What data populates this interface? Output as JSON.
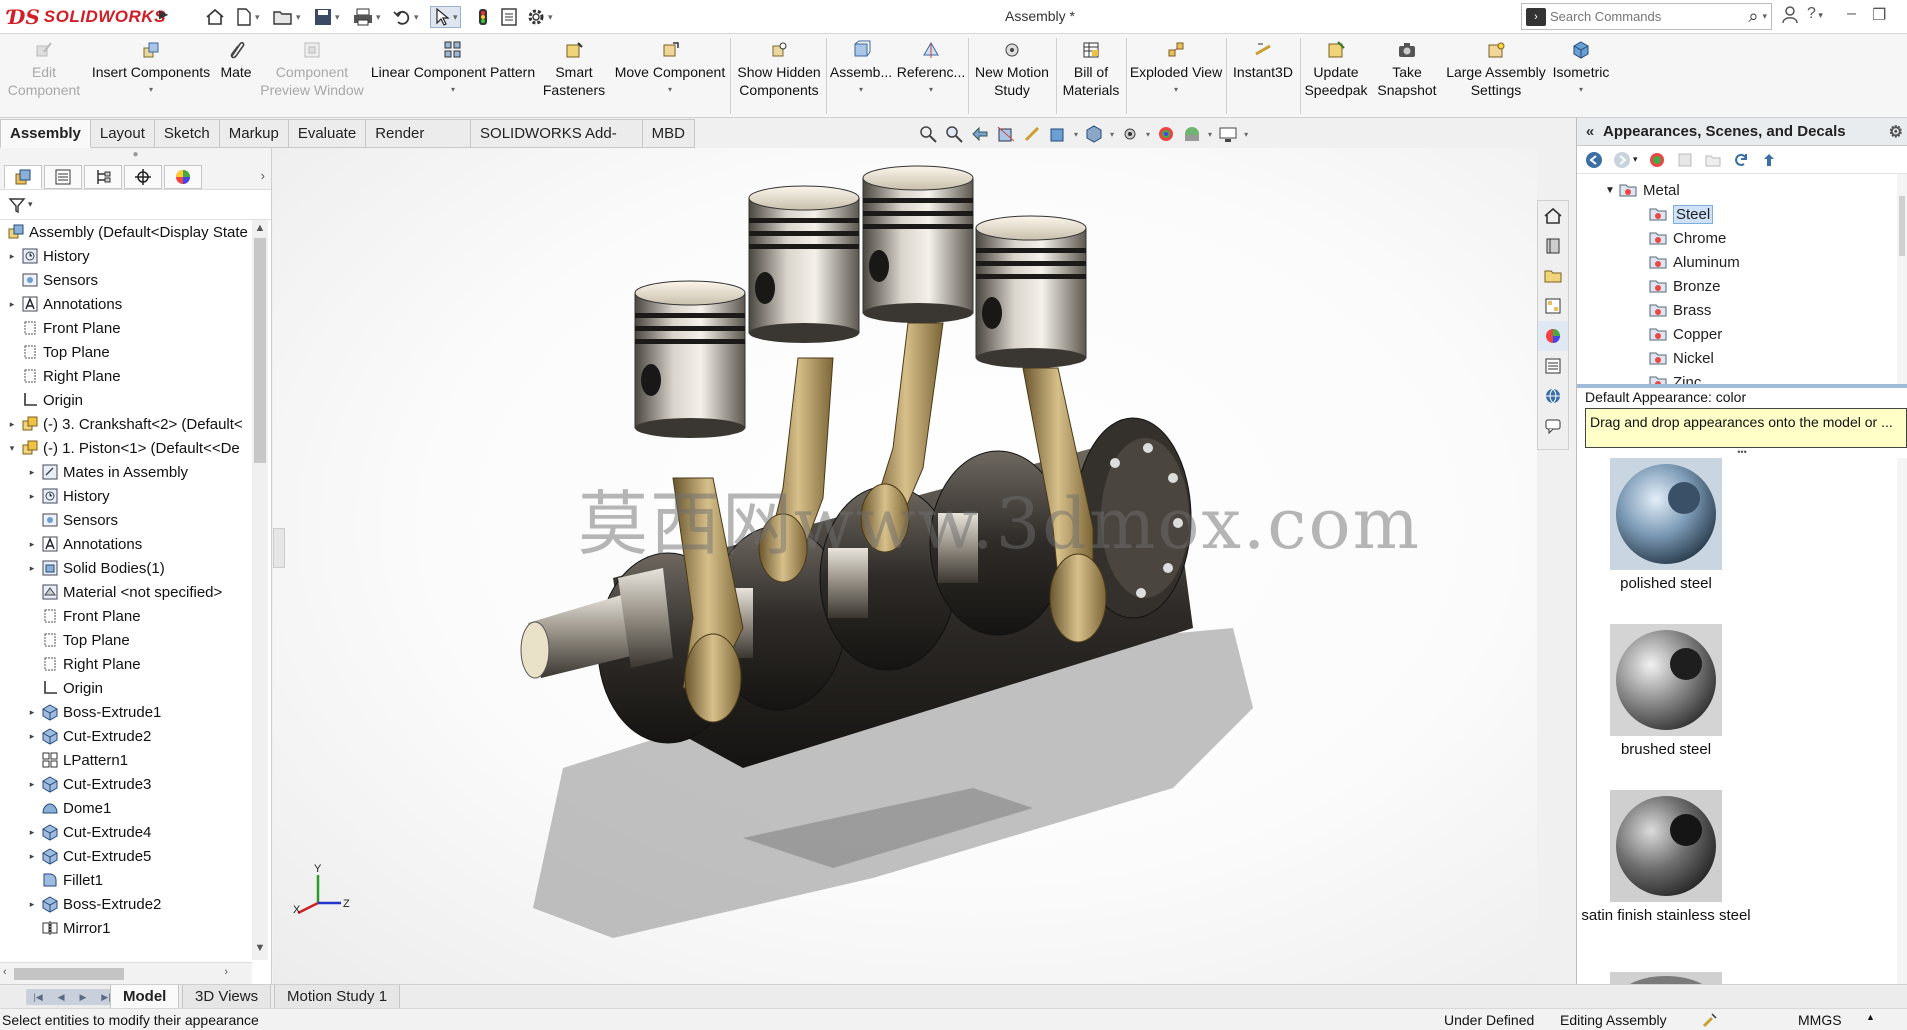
{
  "app": {
    "brand": "SOLIDWORKS",
    "document_title": "Assembly *",
    "search_placeholder": "Search Commands"
  },
  "command_manager": {
    "edit_component": "Edit Component",
    "insert_components": "Insert Components",
    "mate": "Mate",
    "component_preview": "Component Preview Window",
    "linear_pattern": "Linear Component Pattern",
    "smart_fasteners": "Smart Fasteners",
    "move_component": "Move Component",
    "show_hidden": "Show Hidden Components",
    "assembly_features": "Assemb...",
    "reference_geometry": "Referenc...",
    "new_motion_study": "New Motion Study",
    "bill_of_materials": "Bill of Materials",
    "exploded_view": "Exploded View",
    "instant3d": "Instant3D",
    "update_speedpak": "Update Speedpak",
    "take_snapshot": "Take Snapshot",
    "large_assembly": "Large Assembly Settings",
    "isometric": "Isometric"
  },
  "tabs": [
    "Assembly",
    "Layout",
    "Sketch",
    "Markup",
    "Evaluate",
    "Render Tools",
    "SOLIDWORKS Add-Ins",
    "MBD"
  ],
  "feature_tree": {
    "root": "Assembly  (Default<Display State",
    "items": [
      {
        "label": "History",
        "level": 1,
        "expand": true,
        "icon": "history-icon"
      },
      {
        "label": "Sensors",
        "level": 1,
        "expand": false,
        "icon": "sensors-icon"
      },
      {
        "label": "Annotations",
        "level": 1,
        "expand": true,
        "icon": "annotations-icon"
      },
      {
        "label": "Front Plane",
        "level": 1,
        "expand": false,
        "icon": "plane-icon"
      },
      {
        "label": "Top Plane",
        "level": 1,
        "expand": false,
        "icon": "plane-icon"
      },
      {
        "label": "Right Plane",
        "level": 1,
        "expand": false,
        "icon": "plane-icon"
      },
      {
        "label": "Origin",
        "level": 1,
        "expand": false,
        "icon": "origin-icon"
      },
      {
        "label": "(-) 3. Crankshaft<2> (Default<",
        "level": 1,
        "expand": true,
        "icon": "part-icon"
      },
      {
        "label": "(-) 1. Piston<1> (Default<<De",
        "level": 1,
        "expand": "open",
        "icon": "part-icon"
      },
      {
        "label": "Mates in Assembly",
        "level": 2,
        "expand": true,
        "icon": "mates-icon"
      },
      {
        "label": "History",
        "level": 2,
        "expand": true,
        "icon": "history-icon"
      },
      {
        "label": "Sensors",
        "level": 2,
        "expand": false,
        "icon": "sensors-icon"
      },
      {
        "label": "Annotations",
        "level": 2,
        "expand": true,
        "icon": "annotations-icon"
      },
      {
        "label": "Solid Bodies(1)",
        "level": 2,
        "expand": true,
        "icon": "solid-bodies-icon"
      },
      {
        "label": "Material <not specified>",
        "level": 2,
        "expand": false,
        "icon": "material-icon"
      },
      {
        "label": "Front Plane",
        "level": 2,
        "expand": false,
        "icon": "plane-icon"
      },
      {
        "label": "Top Plane",
        "level": 2,
        "expand": false,
        "icon": "plane-icon"
      },
      {
        "label": "Right Plane",
        "level": 2,
        "expand": false,
        "icon": "plane-icon"
      },
      {
        "label": "Origin",
        "level": 2,
        "expand": false,
        "icon": "origin-icon"
      },
      {
        "label": "Boss-Extrude1",
        "level": 2,
        "expand": true,
        "icon": "feature-icon"
      },
      {
        "label": "Cut-Extrude2",
        "level": 2,
        "expand": true,
        "icon": "feature-icon"
      },
      {
        "label": "LPattern1",
        "level": 2,
        "expand": false,
        "icon": "pattern-icon"
      },
      {
        "label": "Cut-Extrude3",
        "level": 2,
        "expand": true,
        "icon": "feature-icon"
      },
      {
        "label": "Dome1",
        "level": 2,
        "expand": false,
        "icon": "dome-icon"
      },
      {
        "label": "Cut-Extrude4",
        "level": 2,
        "expand": true,
        "icon": "feature-icon"
      },
      {
        "label": "Cut-Extrude5",
        "level": 2,
        "expand": true,
        "icon": "feature-icon"
      },
      {
        "label": "Fillet1",
        "level": 2,
        "expand": false,
        "icon": "fillet-icon"
      },
      {
        "label": "Boss-Extrude2",
        "level": 2,
        "expand": true,
        "icon": "feature-icon"
      },
      {
        "label": "Mirror1",
        "level": 2,
        "expand": false,
        "icon": "mirror-icon"
      }
    ]
  },
  "graphics": {
    "watermark": "莫西网www.3dmox.com",
    "triad_x": "X",
    "triad_y": "Y",
    "triad_z": "Z"
  },
  "appearance_pane": {
    "title": "Appearances, Scenes, and Decals",
    "folder": "Metal",
    "items": [
      "Steel",
      "Chrome",
      "Aluminum",
      "Bronze",
      "Brass",
      "Copper",
      "Nickel",
      "Zinc"
    ],
    "selected": "Steel",
    "default_appearance": "Default Appearance: color",
    "tooltip": "Drag and drop appearances onto the model or ...",
    "swatches": [
      "polished steel",
      "brushed steel",
      "satin finish stainless steel"
    ]
  },
  "bottom_tabs": [
    "Model",
    "3D Views",
    "Motion Study 1"
  ],
  "status": {
    "hint": "Select entities to modify their appearance",
    "state": "Under Defined",
    "mode": "Editing Assembly",
    "units": "MMGS"
  },
  "colors": {
    "brand_red": "#d21e26",
    "selection_blue": "#cfe2f7",
    "tooltip_yellow": "#ffffc8",
    "rod_gold": "#b89a5a"
  }
}
